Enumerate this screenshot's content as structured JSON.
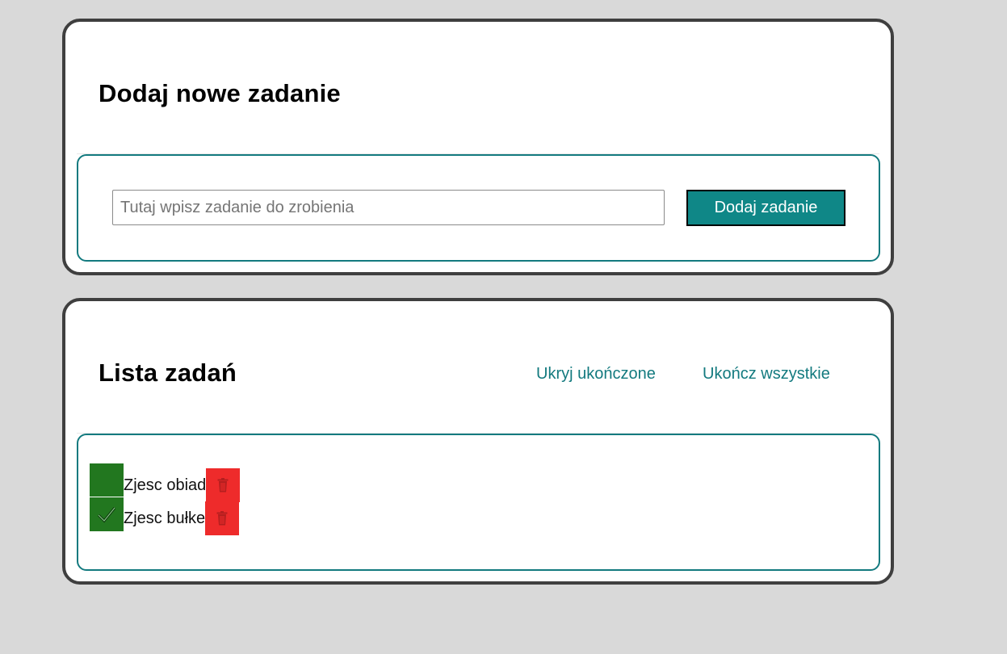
{
  "add_section": {
    "title": "Dodaj nowe zadanie",
    "input_placeholder": "Tutaj wpisz zadanie do zrobienia",
    "input_value": "",
    "add_button_label": "Dodaj zadanie"
  },
  "list_section": {
    "title": "Lista zadań",
    "hide_completed_label": "Ukryj ukończone",
    "complete_all_label": "Ukończ wszystkie",
    "tasks": [
      {
        "text": "Zjesc obiad",
        "completed": false
      },
      {
        "text": "Zjesc bułke",
        "completed": true
      }
    ]
  },
  "icons": {
    "check": "check-icon",
    "delete": "trash-icon"
  },
  "colors": {
    "page_background": "#d9d9d9",
    "accent": "#137a7f",
    "button_background": "#0f8787",
    "checkbox_green": "#22771f",
    "delete_red": "#ee2b2b"
  }
}
